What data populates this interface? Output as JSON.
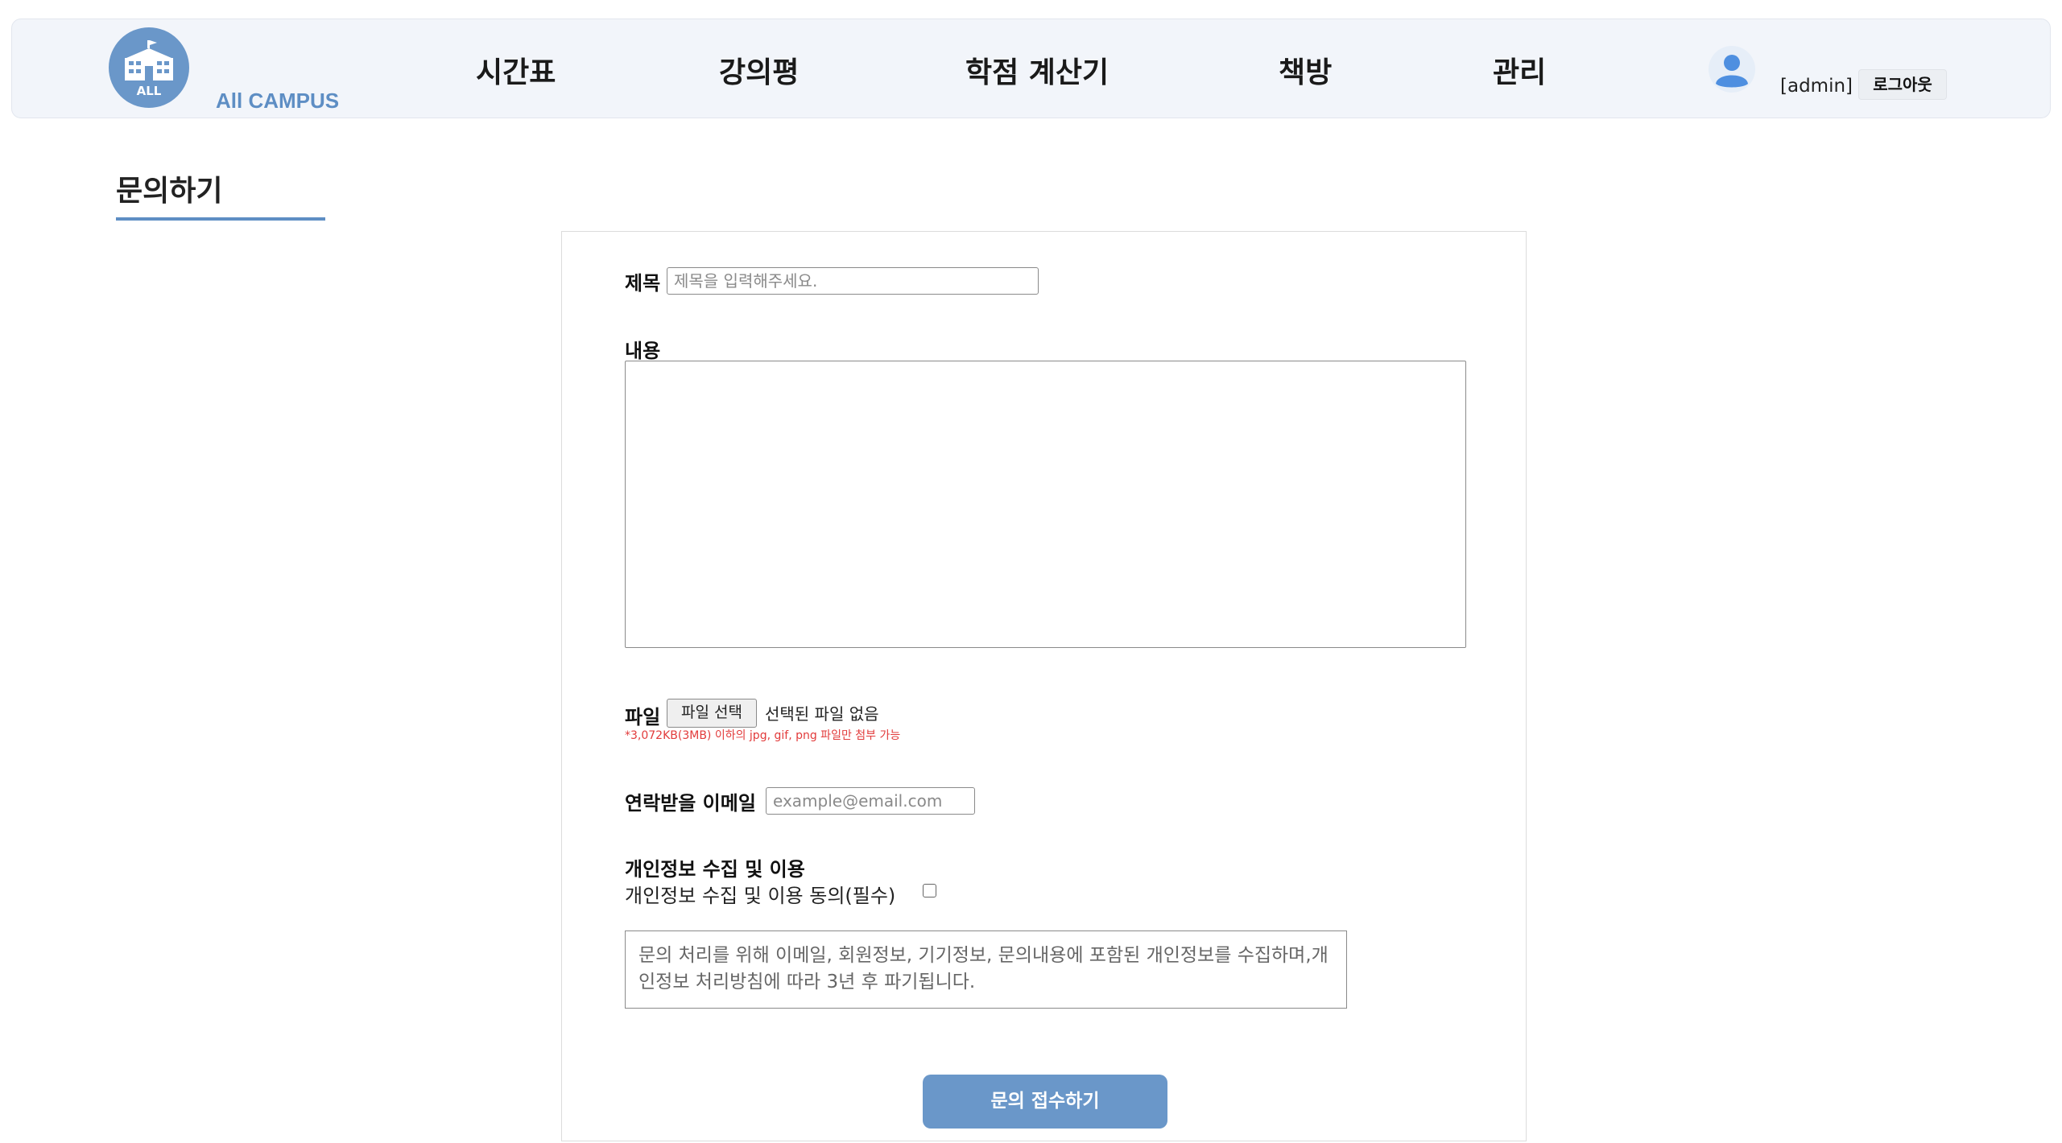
{
  "header": {
    "logo_abbr": "ALL",
    "logo_text": "All CAMPUS",
    "nav": [
      {
        "label": "시간표"
      },
      {
        "label": "강의평"
      },
      {
        "label": "학점 계산기"
      },
      {
        "label": "책방"
      },
      {
        "label": "관리"
      }
    ],
    "user_label": "[admin]",
    "logout_label": "로그아웃"
  },
  "page": {
    "title": "문의하기"
  },
  "form": {
    "title_label": "제목",
    "title_placeholder": "제목을 입력해주세요.",
    "content_label": "내용",
    "file_label": "파일",
    "file_button": "파일 선택",
    "file_status": "선택된 파일 없음",
    "file_note": "*3,072KB(3MB) 이하의 jpg, gif, png 파일만 첨부 가능",
    "email_label": "연락받을 이메일",
    "email_placeholder": "example@email.com",
    "privacy_heading": "개인정보 수집 및 이용",
    "privacy_consent": "개인정보 수집 및 이용 동의(필수)",
    "privacy_text": "문의 처리를 위해 이메일, 회원정보, 기기정보, 문의내용에 포함된 개인정보를 수집하며,개인정보 처리방침에 따라 3년 후 파기됩니다.",
    "submit_label": "문의 접수하기"
  },
  "colors": {
    "accent": "#6a97c9",
    "header_bg": "#f2f5fa",
    "note_red": "#e23b3b"
  }
}
